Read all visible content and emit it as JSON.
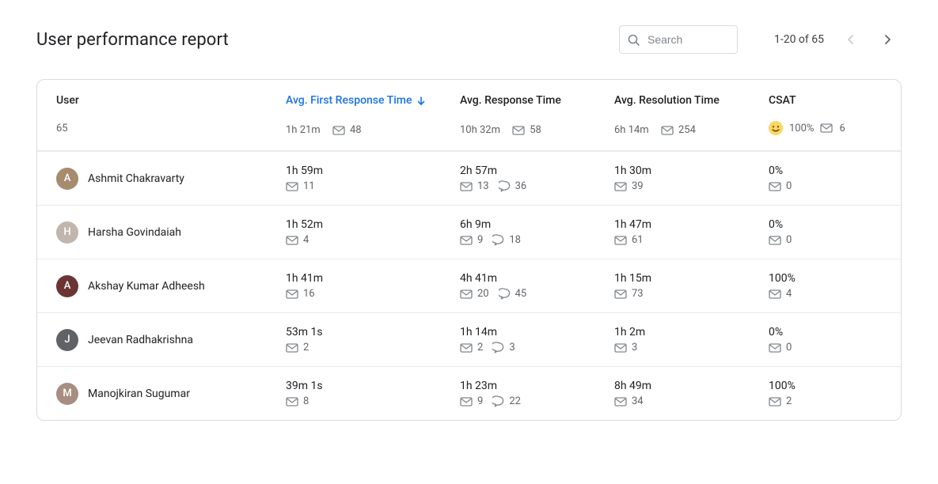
{
  "title": "User performance report",
  "search": {
    "placeholder": "Search"
  },
  "pager": {
    "label": "1-20 of 65"
  },
  "columns": {
    "user": "User",
    "frt": "Avg. First Response Time",
    "rt": "Avg. Response Time",
    "res": "Avg. Resolution Time",
    "csat": "CSAT"
  },
  "summary": {
    "user_count": "65",
    "frt": "1h 21m",
    "frt_mail": "48",
    "rt": "10h 32m",
    "rt_mail": "58",
    "res": "6h 14m",
    "res_mail": "254",
    "csat": "100%",
    "csat_mail": "6"
  },
  "rows": [
    {
      "name": "Ashmit Chakravarty",
      "avatar_initial": "A",
      "avatar_bg": "#a78b6d",
      "frt": "1h 59m",
      "frt_mail": "11",
      "rt": "2h 57m",
      "rt_mail": "13",
      "rt_chat": "36",
      "res": "1h 30m",
      "res_mail": "39",
      "csat": "0%",
      "csat_mail": "0"
    },
    {
      "name": "Harsha Govindaiah",
      "avatar_initial": "H",
      "avatar_bg": "#c0b6ad",
      "frt": "1h 52m",
      "frt_mail": "4",
      "rt": "6h 9m",
      "rt_mail": "9",
      "rt_chat": "18",
      "res": "1h 47m",
      "res_mail": "61",
      "csat": "0%",
      "csat_mail": "0"
    },
    {
      "name": "Akshay Kumar Adheesh",
      "avatar_initial": "A",
      "avatar_bg": "#6b3534",
      "frt": "1h 41m",
      "frt_mail": "16",
      "rt": "4h 41m",
      "rt_mail": "20",
      "rt_chat": "45",
      "res": "1h 15m",
      "res_mail": "73",
      "csat": "100%",
      "csat_mail": "4"
    },
    {
      "name": "Jeevan Radhakrishna",
      "avatar_initial": "J",
      "avatar_bg": "#5f6368",
      "frt": "53m 1s",
      "frt_mail": "2",
      "rt": "1h 14m",
      "rt_mail": "2",
      "rt_chat": "3",
      "res": "1h 2m",
      "res_mail": "3",
      "csat": "0%",
      "csat_mail": "0"
    },
    {
      "name": "Manojkiran Sugumar",
      "avatar_initial": "M",
      "avatar_bg": "#a68f82",
      "frt": "39m 1s",
      "frt_mail": "8",
      "rt": "1h 23m",
      "rt_mail": "9",
      "rt_chat": "22",
      "res": "8h 49m",
      "res_mail": "34",
      "csat": "100%",
      "csat_mail": "2"
    }
  ]
}
